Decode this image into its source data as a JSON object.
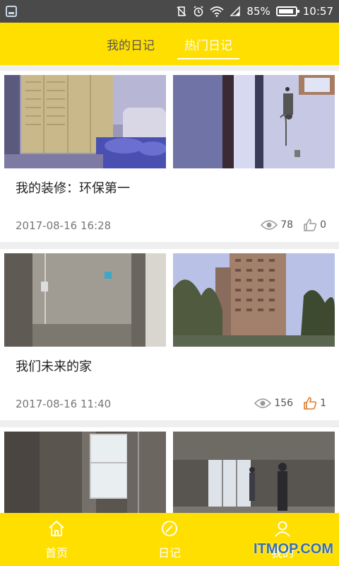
{
  "statusbar": {
    "battery": "85%",
    "time": "10:57"
  },
  "tabs": [
    {
      "label": "我的日记",
      "active": false
    },
    {
      "label": "热门日记",
      "active": true
    }
  ],
  "cards": [
    {
      "title": "我的装修：环保第一",
      "date": "2017-08-16 16:28",
      "views": "78",
      "likes": "0",
      "liked": false
    },
    {
      "title": "我们未来的家",
      "date": "2017-08-16 11:40",
      "views": "156",
      "likes": "1",
      "liked": true
    },
    {
      "title": "",
      "date": "",
      "views": "",
      "likes": "",
      "liked": false
    }
  ],
  "bottom_nav": [
    {
      "label": "首页",
      "icon": "home-icon"
    },
    {
      "label": "日记",
      "icon": "compose-icon"
    },
    {
      "label": "我的",
      "icon": "user-icon"
    }
  ],
  "watermark": "ITMOP.COM",
  "colors": {
    "accent": "#ffdf00",
    "like_active": "#e07a2e"
  }
}
